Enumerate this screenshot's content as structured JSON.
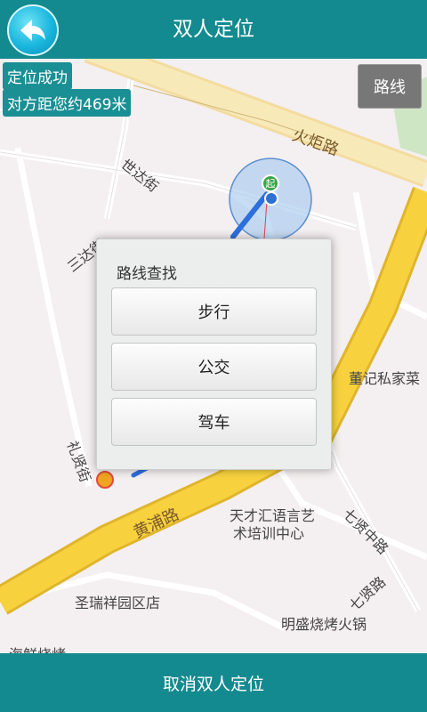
{
  "header": {
    "title": "双人定位"
  },
  "status": {
    "located": "定位成功",
    "distance": "对方距您约469米"
  },
  "route_button": "路线",
  "map": {
    "roads": [
      "火炬路",
      "世达街",
      "三达街",
      "黄浦路",
      "七贤中路",
      "七贤路",
      "礼贤街"
    ],
    "pois": [
      "董记私家菜",
      "天才汇语言艺",
      "术培训中心",
      "圣瑞祥园区店",
      "明盛烧烤火锅",
      "海鲜烧烤"
    ],
    "start_marker": "起"
  },
  "dialog": {
    "title": "路线查找",
    "options": [
      "步行",
      "公交",
      "驾车"
    ]
  },
  "footer": {
    "cancel_label": "取消双人定位"
  }
}
